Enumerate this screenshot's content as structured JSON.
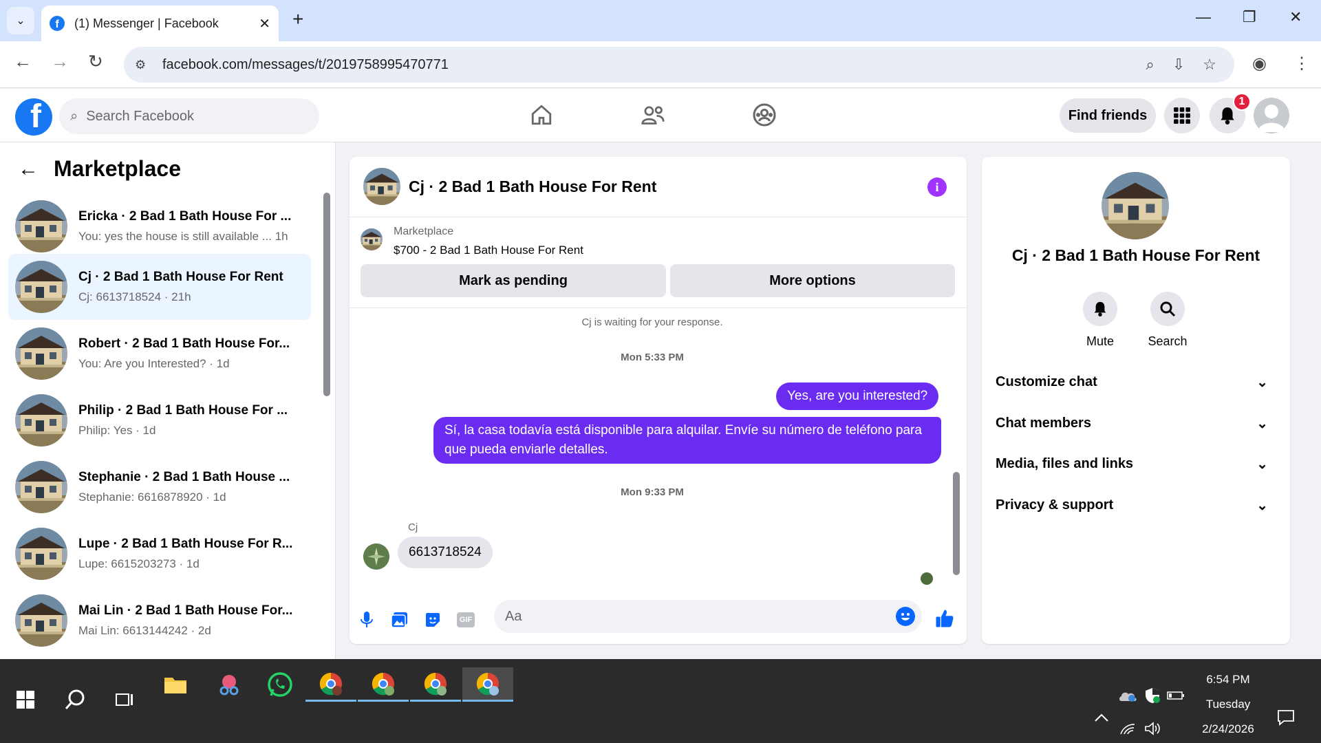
{
  "browser": {
    "tab_title": "(1) Messenger | Facebook",
    "url": "facebook.com/messages/t/2019758995470771"
  },
  "fb": {
    "search_placeholder": "Search Facebook",
    "find_friends": "Find friends",
    "notification_count": "1"
  },
  "sidebar": {
    "title": "Marketplace",
    "conversations": [
      {
        "name": "Ericka · 2 Bad 1 Bath House For ...",
        "preview": "You: yes the house is still available ...  1h"
      },
      {
        "name": "Cj · 2 Bad 1 Bath House For Rent",
        "preview": "Cj: 6613718524 · 21h"
      },
      {
        "name": "Robert · 2 Bad 1 Bath House For...",
        "preview": "You: Are you Interested? · 1d"
      },
      {
        "name": "Philip · 2 Bad 1 Bath House For ...",
        "preview": "Philip: Yes · 1d"
      },
      {
        "name": "Stephanie · 2 Bad 1 Bath House ...",
        "preview": "Stephanie: 6616878920 · 1d"
      },
      {
        "name": "Lupe · 2 Bad 1 Bath House For R...",
        "preview": "Lupe: 6615203273 · 1d"
      },
      {
        "name": "Mai Lin · 2 Bad 1 Bath House For...",
        "preview": "Mai Lin: 6613144242 · 2d"
      }
    ]
  },
  "chat": {
    "title": "Cj · 2 Bad 1 Bath House For Rent",
    "marketplace_label": "Marketplace",
    "listing": "$700 - 2 Bad 1 Bath House For Rent",
    "mark_pending": "Mark as pending",
    "more_options": "More options",
    "waiting_note": "Cj is waiting for your response.",
    "timestamp_1": "Mon 5:33 PM",
    "msg_out_1": "Yes, are you interested?",
    "msg_out_2": "Sí, la casa todavía está disponible para alquilar. Envíe su número de teléfono para que pueda enviarle detalles.",
    "timestamp_2": "Mon 9:33 PM",
    "sender": "Cj",
    "msg_in_1": "6613718524",
    "composer_placeholder": "Aa",
    "gif_label": "GIF"
  },
  "info": {
    "name": "Cj · 2 Bad 1 Bath House For Rent",
    "mute": "Mute",
    "search": "Search",
    "rows": [
      "Customize chat",
      "Chat members",
      "Media, files and links",
      "Privacy & support"
    ]
  },
  "taskbar": {
    "time": "6:54 PM",
    "day": "Tuesday",
    "date": "2/24/2026"
  },
  "colors": {
    "fb_blue": "#1877f2",
    "outgoing_bubble": "#6a2cf0",
    "active_conversation": "#ebf5ff",
    "notification_red": "#e41e3f"
  }
}
